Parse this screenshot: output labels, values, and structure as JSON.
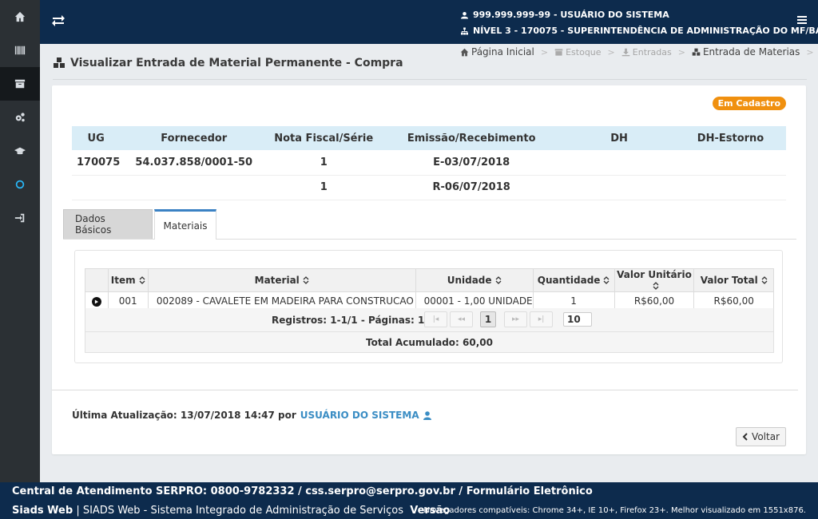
{
  "header": {
    "user_line": "999.999.999-99 - USUÁRIO DO SISTEMA",
    "level_line": "NÍVEL 3 - 170075 - SUPERINTENDÊNCIA DE ADMINISTRAÇÃO DO MF/BA"
  },
  "page": {
    "title": "Visualizar Entrada de Material Permanente - Compra"
  },
  "breadcrumb": [
    "Página Inicial",
    "Estoque",
    "Entradas",
    "Entrada de Materias"
  ],
  "status_badge": "Em Cadastro",
  "summary": {
    "headers": [
      "UG",
      "Fornecedor",
      "Nota Fiscal/Série",
      "Emissão/Recebimento",
      "DH",
      "DH-Estorno"
    ],
    "rows": [
      [
        "170075",
        "54.037.858/0001-50",
        "1",
        "E-03/07/2018",
        "",
        ""
      ],
      [
        "",
        "",
        "1",
        "R-06/07/2018",
        "",
        ""
      ]
    ]
  },
  "tabs": [
    "Dados Básicos",
    "Materiais"
  ],
  "materials": {
    "headers": [
      "Item",
      "Material",
      "Unidade",
      "Quantidade",
      "Valor Unitário",
      "Valor Total"
    ],
    "rows": [
      [
        "001",
        "002089 - CAVALETE EM MADEIRA PARA CONSTRUCAO",
        "00001 - 1,00 UNIDADE",
        "1",
        "R$60,00",
        "R$60,00"
      ]
    ],
    "pager_info": "Registros: 1-1/1 - Páginas: 1/1",
    "current_page": "1",
    "page_size": "10",
    "total": "Total Acumulado: 60,00"
  },
  "last_update": {
    "label": "Última Atualização: 13/07/2018 14:47 por",
    "user": "USUÁRIO DO SISTEMA"
  },
  "back_label": "Voltar",
  "footer": {
    "line1": "Central de Atendimento SERPRO: 0800-9782332 / css.serpro@serpro.gov.br / Formulário Eletrônico",
    "brand": "Siads Web",
    "system": "| SIADS Web - Sistema Integrado de Administração de Serviços",
    "version": "Versão",
    "browsers": "Navegadores compatíveis: Chrome 34+, IE 10+, Firefox 23+. Melhor visualizado em 1551x876."
  }
}
